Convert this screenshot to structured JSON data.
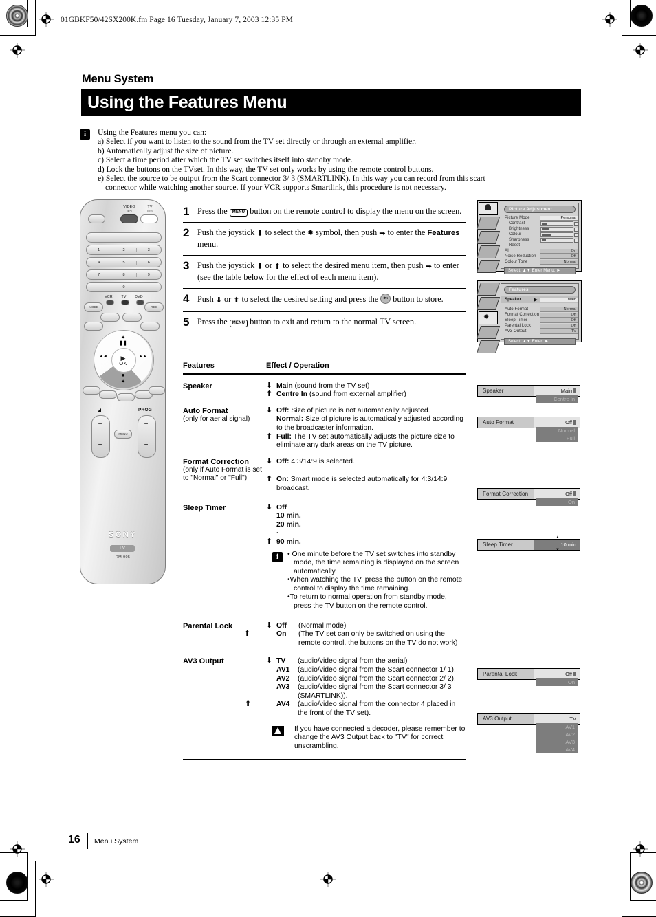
{
  "header": {
    "file_line": "01GBKF50/42SX200K.fm  Page 16  Tuesday, January 7, 2003  12:35 PM"
  },
  "title": {
    "kicker": "Menu System",
    "main": "Using the Features Menu"
  },
  "intro": {
    "icon": "info-icon",
    "lead": "Using the Features menu you can:",
    "items": [
      "a) Select if you want to listen to the sound from the TV set directly or through an external amplifier.",
      "b) Automatically adjust the size of picture.",
      "c) Select a time period after which the TV set switches itself into standby mode.",
      "d) Lock the buttons on the TVset. In this way, the TV set only works by using the remote control buttons.",
      "e) Select the source to be output from the Scart connector  3/ 3 (SMARTLINK). In this way you can record from this scart",
      "connector while watching another source. If your VCR supports Smartlink, this procedure is not necessary."
    ]
  },
  "steps": [
    {
      "num": "1",
      "pre": "Press the ",
      "key": "MENU",
      "post": " button on the remote control to display the menu on the screen."
    },
    {
      "num": "2",
      "pre": "Push the joystick ",
      "post": " to select the ",
      "post2": " symbol, then push ",
      "post3": " to enter the ",
      "bold": "Features",
      "post4": " menu."
    },
    {
      "num": "3",
      "pre": "Push the joystick ",
      "post": " or ",
      "post2": " to select the desired menu item, then push ",
      "post3": " to enter (see the table below for the effect of each menu item)."
    },
    {
      "num": "4",
      "pre": "Push ",
      "post": " or ",
      "post2": " to select the desired setting and press the ",
      "post3": " button to store."
    },
    {
      "num": "5",
      "pre": "Press the ",
      "key": "MENU",
      "post": " button to exit and return to the normal TV screen."
    }
  ],
  "table": {
    "head": {
      "col1": "Features",
      "col2": "Effect / Operation"
    },
    "rows": [
      {
        "name": "Speaker",
        "sub": "",
        "options": [
          {
            "arrow": "down",
            "bold": "Main",
            "text": " (sound from the TV set)"
          },
          {
            "arrow": "up",
            "bold": "Centre In",
            "text": " (sound from external amplifier)"
          }
        ]
      },
      {
        "name": "Auto Format",
        "sub": "(only for aerial signal)",
        "options": [
          {
            "arrow": "down",
            "bold": "Off:",
            "text": " Size of picture is not automatically adjusted."
          },
          {
            "arrow": "none",
            "bold": "Normal:",
            "text": " Size of picture is automatically adjusted according to the broadcaster information."
          },
          {
            "arrow": "up",
            "bold": "Full:",
            "text": " The TV set automatically adjusts the picture size to eliminate any dark areas on the TV picture."
          }
        ]
      },
      {
        "name": "Format Correction",
        "sub": "(only if Auto Format is set to \"Normal\" or \"Full\")",
        "options": [
          {
            "arrow": "down",
            "bold": "Off:",
            "text": " 4:3/14:9 is selected."
          },
          {
            "arrow": "spacer",
            "bold": "",
            "text": ""
          },
          {
            "arrow": "up",
            "bold": "On:",
            "text": " Smart mode is selected automatically for 4:3/14:9 broadcast."
          }
        ]
      },
      {
        "name": "Sleep Timer",
        "sub": "",
        "options": [
          {
            "arrow": "down",
            "bold": "Off",
            "text": ""
          },
          {
            "arrow": "none",
            "bold": "10 min.",
            "text": ""
          },
          {
            "arrow": "none",
            "bold": "20 min.",
            "text": ""
          },
          {
            "arrow": "none",
            "bold": ":",
            "text": ""
          },
          {
            "arrow": "up",
            "bold": "90 min.",
            "text": ""
          }
        ],
        "tips": [
          "• One minute before the TV set switches into standby mode, the time remaining is displayed on the screen automatically.",
          "•When watching the TV, press the  button on  the remote control to display the time remaining.",
          "•To return to normal operation from standby mode, press the TV  button on the remote control."
        ]
      },
      {
        "name": "Parental Lock",
        "sub": "",
        "options": [
          {
            "arrow": "down",
            "bold": "Off",
            "text": "(Normal mode)"
          },
          {
            "arrow": "up",
            "bold": "On",
            "text": "(The TV set can only be switched on using the remote control, the buttons on the TV do not work)"
          }
        ]
      },
      {
        "name": "AV3 Output",
        "sub": "",
        "options": [
          {
            "arrow": "down",
            "bold": "TV",
            "text": "(audio/video signal from the aerial)"
          },
          {
            "arrow": "none",
            "bold": "AV1",
            "text": "(audio/video signal from the Scart connector  1/  1)."
          },
          {
            "arrow": "none",
            "bold": "AV2",
            "text": "(audio/video signal from the Scart connector  2/  2)."
          },
          {
            "arrow": "none",
            "bold": "AV3",
            "text": "(audio/video signal from the Scart connector  3/ 3 (SMARTLINK))."
          },
          {
            "arrow": "up",
            "bold": "AV4",
            "text": "(audio/video signal from the connector  4 placed in the front of the TV set)."
          }
        ],
        "warning": "If you have connected a decoder, please remember to change the AV3 Output back to \"TV\" for correct unscrambling."
      }
    ]
  },
  "osd": {
    "picture": {
      "title": "Picture Adjustment",
      "rows": [
        {
          "label": "Picture Mode",
          "value": "Personal",
          "type": "value",
          "highlight": true
        },
        {
          "label": "Contrast",
          "value": "",
          "type": "slider",
          "fill": 18
        },
        {
          "label": "Brightness",
          "value": "",
          "type": "slider",
          "fill": 24
        },
        {
          "label": "Colour",
          "value": "",
          "type": "slider",
          "fill": 30
        },
        {
          "label": "Sharpness",
          "value": "",
          "type": "slider",
          "fill": 14
        },
        {
          "label": "Reset",
          "value": "",
          "type": "plain"
        },
        {
          "label": "AI",
          "value": "On",
          "type": "value"
        },
        {
          "label": "Noise Reduction",
          "value": "Off",
          "type": "value"
        },
        {
          "label": "Colour Tone",
          "value": "Normal",
          "type": "value"
        }
      ],
      "footer": "Select: ▲▼ Enter Menu: ►"
    },
    "features": {
      "title": "Features",
      "rows": [
        {
          "label": "Speaker",
          "value": "Main",
          "type": "value",
          "highlight": true,
          "cursor": true
        },
        {
          "label": "Auto Format",
          "value": "Normal",
          "type": "value"
        },
        {
          "label": " Format Correction",
          "value": "Off",
          "type": "value"
        },
        {
          "label": "Sleep Timer",
          "value": "Off",
          "type": "value"
        },
        {
          "label": "Parental Lock",
          "value": "Off",
          "type": "value"
        },
        {
          "label": "AV3 Output",
          "value": "TV",
          "type": "value"
        }
      ],
      "footer": "Select: ▲▼ Enter: ►"
    },
    "bars": [
      {
        "label": "Speaker",
        "value": "Main",
        "options": [
          "Centre In"
        ]
      },
      {
        "label": "Auto Format",
        "value": "Off",
        "options": [
          "Normal",
          "Full"
        ]
      },
      {
        "label": "Format Correction",
        "value": "Off",
        "options": [
          "On"
        ]
      },
      {
        "label": "Sleep Timer",
        "value": "10 min",
        "options": []
      },
      {
        "label": "Parental Lock",
        "value": "Off",
        "options": [
          "On"
        ]
      },
      {
        "label": "AV3 Output",
        "value": "TV",
        "options": [
          "AV1",
          "AV2",
          "AV3",
          "AV4"
        ]
      }
    ]
  },
  "remote": {
    "video_label": "VIDEO",
    "video_power": "I/⏻",
    "tv_label": "TV",
    "tv_power": "I/⏻",
    "keys": [
      [
        "",
        "",
        ""
      ],
      [
        "1",
        "2",
        "3"
      ],
      [
        "4",
        "5",
        "6"
      ],
      [
        "7",
        "8",
        "9"
      ],
      [
        "",
        "0",
        ""
      ]
    ],
    "device_labels": [
      "VCR",
      "TV",
      "DVD"
    ],
    "mode_label": "MODE",
    "rec_label": "REC",
    "volume_symbol": "◢",
    "prog_label": "PROG",
    "menu_label": "MENU",
    "ok_label": "OK",
    "plus": "+",
    "minus": "−",
    "brand": "SONY",
    "tv_tag": "TV",
    "model": "RM-905"
  },
  "footer": {
    "page": "16",
    "section": "Menu System"
  }
}
